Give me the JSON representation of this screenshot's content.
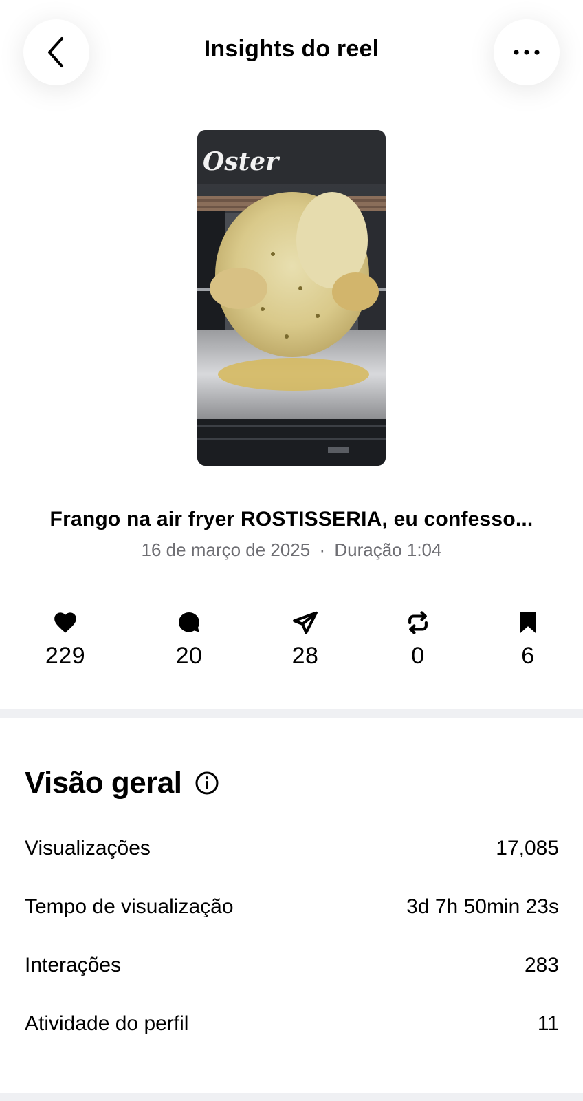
{
  "header": {
    "title": "Insights do reel",
    "back_icon": "chevron-left-icon",
    "more_icon": "more-horizontal-icon"
  },
  "reel": {
    "thumbnail_brand_text": "Oster",
    "title": "Frango na air fryer ROSTISSERIA, eu confesso...",
    "date": "16 de março de 2025",
    "separator": "·",
    "duration": "Duração 1:04"
  },
  "stats": [
    {
      "icon": "heart-icon",
      "value": "229"
    },
    {
      "icon": "comment-icon",
      "value": "20"
    },
    {
      "icon": "share-icon",
      "value": "28"
    },
    {
      "icon": "repost-icon",
      "value": "0"
    },
    {
      "icon": "bookmark-icon",
      "value": "6"
    }
  ],
  "overview": {
    "title": "Visão geral",
    "info_icon": "info-icon",
    "rows": [
      {
        "label": "Visualizações",
        "value": "17,085"
      },
      {
        "label": "Tempo de visualização",
        "value": "3d 7h 50min 23s"
      },
      {
        "label": "Interações",
        "value": "283"
      },
      {
        "label": "Atividade do perfil",
        "value": "11"
      }
    ]
  },
  "colors": {
    "divider": "#eff0f3",
    "meta_text": "#6e6e73"
  }
}
